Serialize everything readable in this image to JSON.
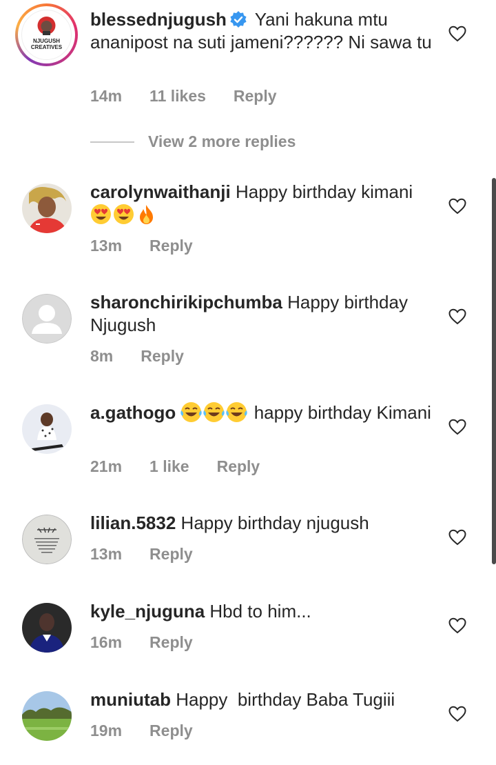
{
  "comments": [
    {
      "username": "blessednjugush",
      "verified": true,
      "text": "Yani hakuna mtu ananipost na suti jameni?????? Ni sawa tu",
      "time": "14m",
      "likes": "11 likes",
      "reply": "Reply",
      "avatar_text": "NJUGUSH CREATIVES"
    },
    {
      "username": "carolynwaithanji",
      "text": "Happy birthday kimani",
      "emojis": [
        "heart-eyes-emoji",
        "heart-eyes-emoji",
        "fire-emoji"
      ],
      "time": "13m",
      "reply": "Reply"
    },
    {
      "username": "sharonchirikipchumba",
      "text": "Happy birthday Njugush",
      "time": "8m",
      "reply": "Reply"
    },
    {
      "username": "a.gathogo",
      "text_after_emojis": "happy birthday Kimani",
      "emojis": [
        "tears-of-joy-emoji",
        "tears-of-joy-emoji",
        "tears-of-joy-emoji"
      ],
      "time": "21m",
      "likes": "1 like",
      "reply": "Reply"
    },
    {
      "username": "lilian.5832",
      "text": "Happy birthday njugush",
      "time": "13m",
      "reply": "Reply"
    },
    {
      "username": "kyle_njuguna",
      "text": "Hbd to him...",
      "time": "16m",
      "reply": "Reply"
    },
    {
      "username": "muniutab",
      "text": "Happy  birthday Baba Tugiii",
      "time": "19m",
      "reply": "Reply"
    }
  ],
  "view_more_replies": "View 2 more replies",
  "colors": {
    "text": "#262626",
    "secondary": "#8e8e8e",
    "verified": "#3897f0"
  }
}
